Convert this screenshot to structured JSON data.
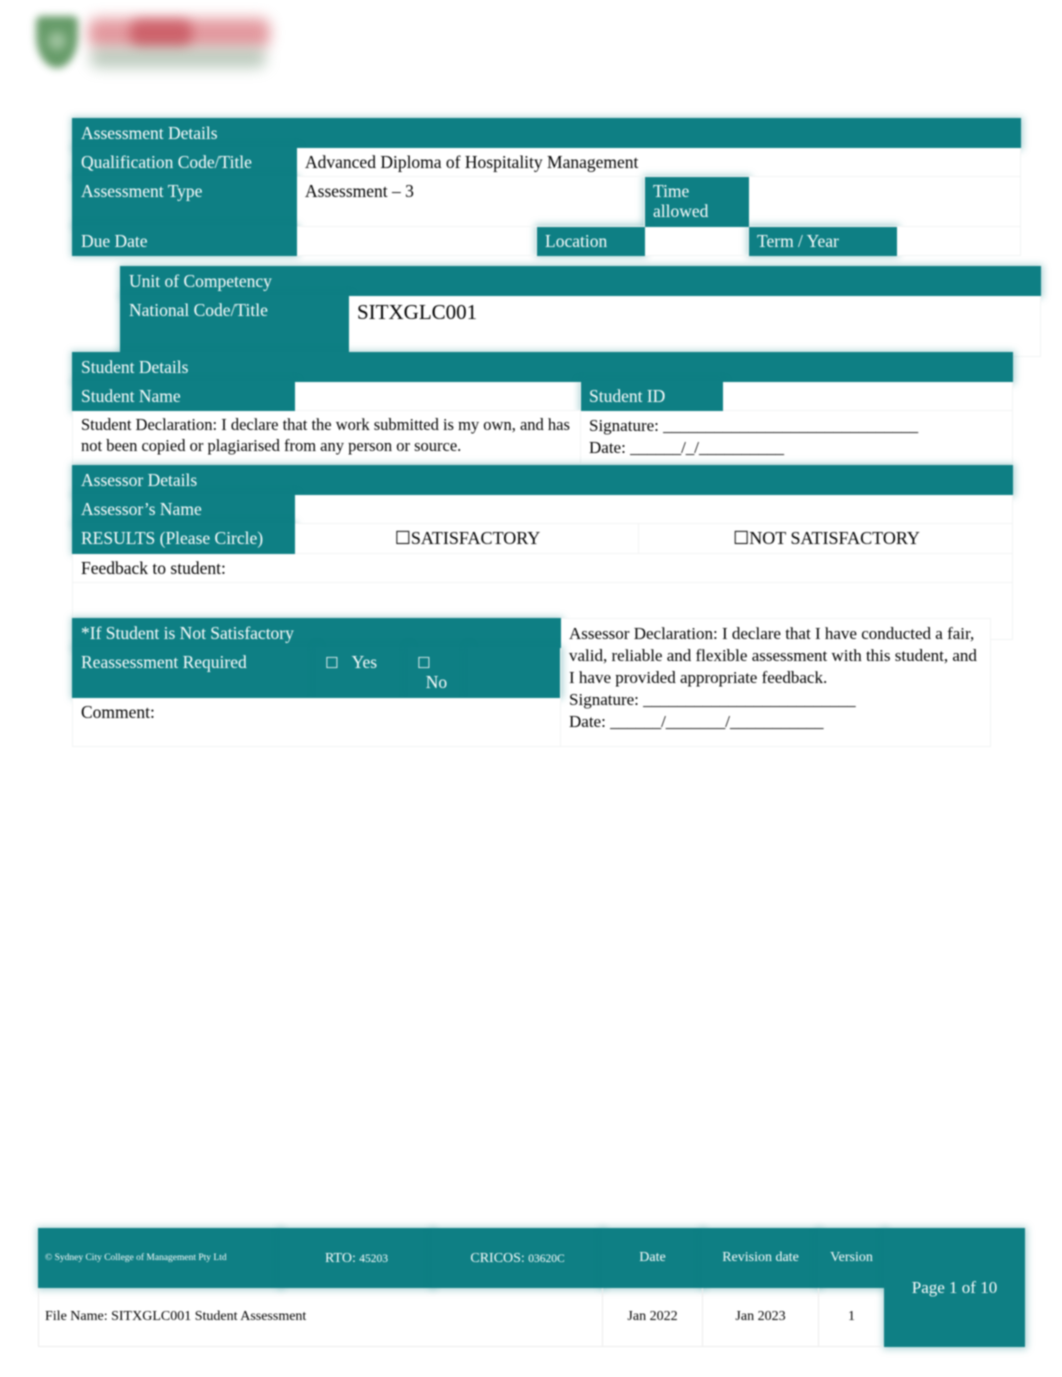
{
  "logo": {
    "name": "sydney-city-college-logo"
  },
  "assessment_details": {
    "section_title": "Assessment Details",
    "rows": [
      {
        "label": "Qualification Code/Title",
        "value": "Advanced Diploma of Hospitality Management"
      },
      {
        "label": "Assessment Type",
        "value": "Assessment – 3"
      }
    ],
    "time_allowed_label": "Time allowed",
    "time_allowed_value": "",
    "due_date_label": "Due Date",
    "due_date_value": "",
    "location_label": "Location",
    "location_value": "",
    "term_year_label": "Term / Year",
    "term_year_value": ""
  },
  "unit_of_competency": {
    "section_title": "Unit of Competency",
    "national_code_label": "National Code/Title",
    "national_code_value": "SITXGLC001"
  },
  "student_details": {
    "section_title": "Student Details",
    "student_name_label": "Student Name",
    "student_name_value": "",
    "student_id_label": "Student ID",
    "student_id_value": "",
    "declaration": "Student Declaration:   I declare that the work submitted is my own, and has not been copied or plagiarised from any person or source.",
    "signature_label": "Signature: ______________________________",
    "date_label": "Date:          ______/_/__________"
  },
  "assessor_details": {
    "section_title": "Assessor Details",
    "assessor_name_label": "Assessor’s Name",
    "assessor_name_value": "",
    "results_label": "RESULTS (Please Circle)",
    "result_satisfactory": "☐SATISFACTORY",
    "result_not_satisfactory": "☐NOT SATISFACTORY",
    "feedback_label": "Feedback to student:",
    "feedback_value": ""
  },
  "reassessment": {
    "heading": "*If Student is Not Satisfactory",
    "required_label": "Reassessment Required",
    "yes_checkbox": "☐",
    "yes_label": "Yes",
    "no_checkbox": "☐",
    "no_label": "No",
    "comment_label": "Comment:",
    "comment_value": "",
    "assessor_declaration": "Assessor Declaration:  I declare that I have conducted a fair, valid, reliable and flexible assessment with this student, and I have provided appropriate feedback.",
    "signature_label": " Signature:       _________________________",
    "date_label": "Date:            ______/_______/___________"
  },
  "footer": {
    "copyright": "© Sydney City College of Management Pty Ltd",
    "rto_label": "RTO:",
    "rto_value": "45203",
    "cricos_label": "CRICOS:",
    "cricos_value": "03620C",
    "date_header": "Date",
    "revision_header": "Revision date",
    "version_header": "Version",
    "file_name": "File Name: SITXGLC001 Student Assessment",
    "date_value": "Jan 2022",
    "revision_value": "Jan 2023",
    "version_value": "1",
    "page_number": "Page 1 of 10"
  },
  "colors": {
    "teal": "#0e7f84",
    "white": "#ffffff",
    "logo_green": "#4c8a4f",
    "logo_red": "#c8545e"
  }
}
